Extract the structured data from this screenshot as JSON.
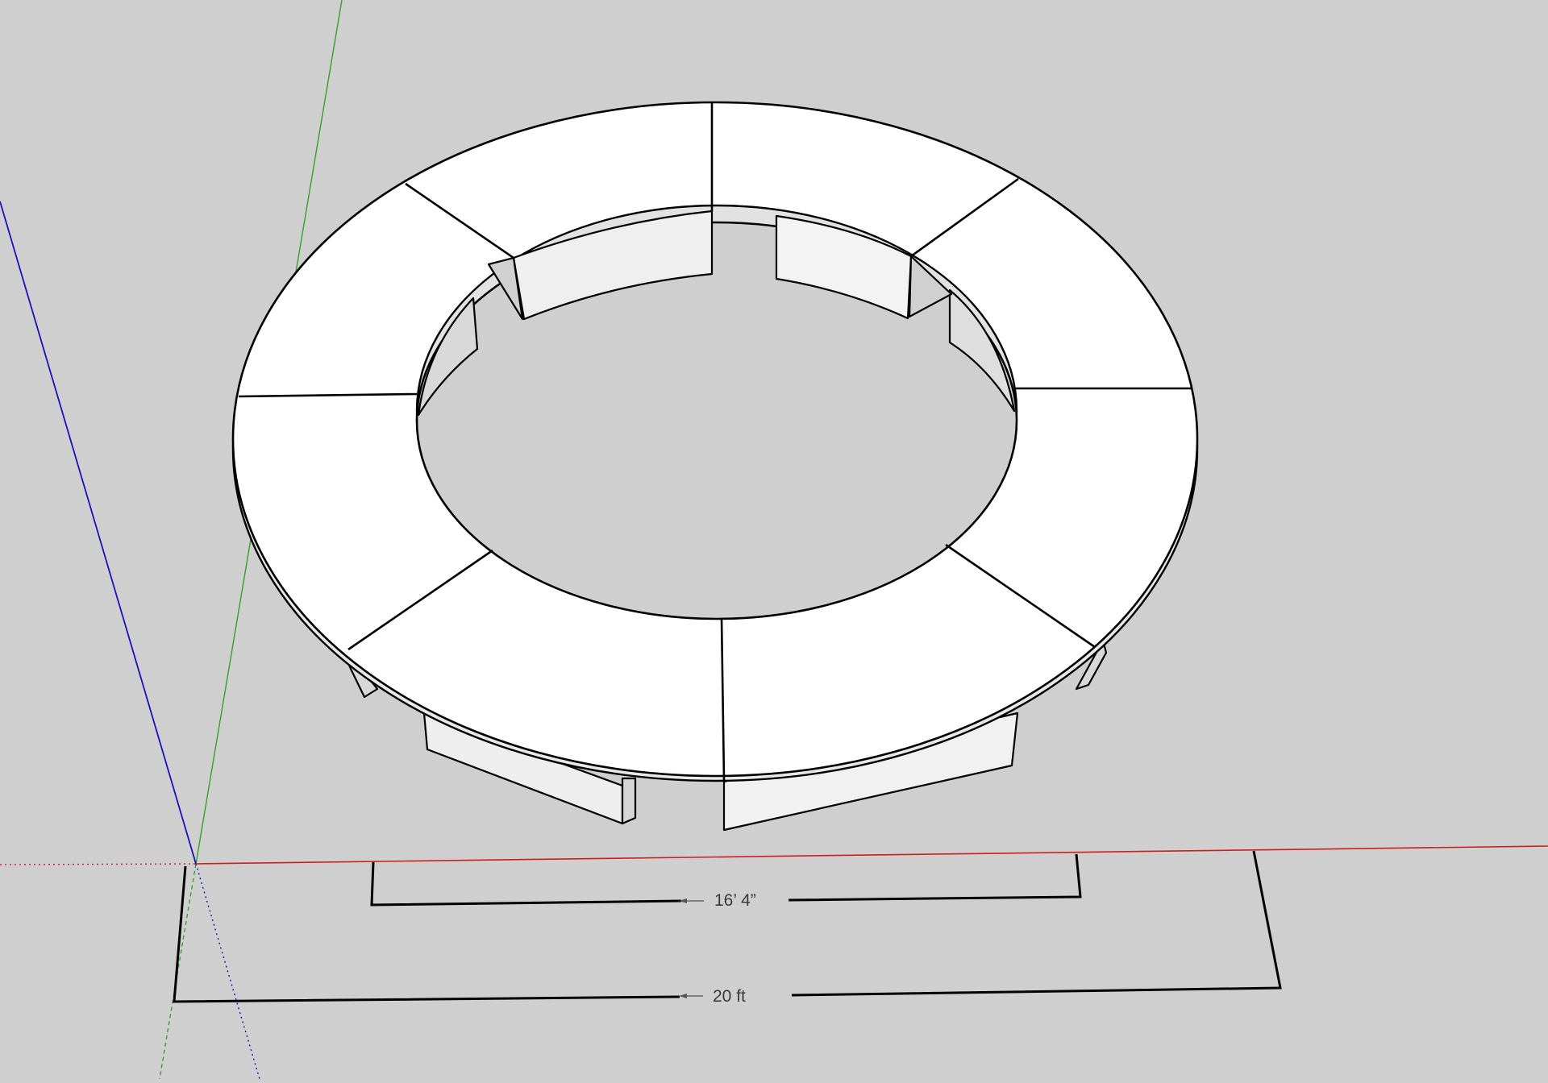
{
  "viewport": {
    "background": "#cfcfcf",
    "axes": {
      "red_axis_color": "#c8201c",
      "green_axis_color": "#36a02a",
      "blue_axis_color": "#1c10b8"
    }
  },
  "model": {
    "description_icon": "ring-table-icon",
    "top_color": "#ffffff",
    "side_color": "#e4e4e4",
    "edge_color": "#000000",
    "segment_count": 8
  },
  "dimensions": [
    {
      "name": "inner-diameter",
      "label": "16’ 4”"
    },
    {
      "name": "outer-diameter",
      "label": "20 ft"
    }
  ]
}
